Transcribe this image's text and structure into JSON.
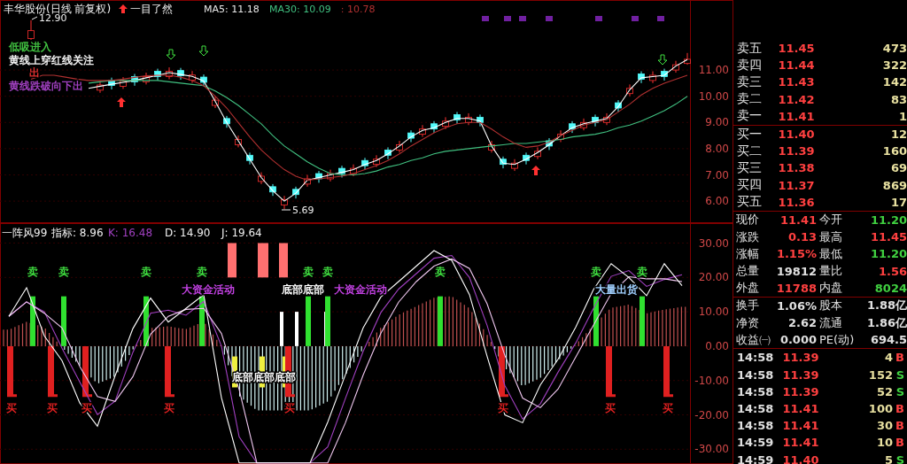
{
  "price_chart": {
    "title": "丰华股份(日线 前复权)",
    "indicator": "一目了然",
    "ma_legend": [
      {
        "label": "MA5: 11.18",
        "color": "#e8e8e8"
      },
      {
        "label": "MA30: 10.09",
        "color": "#40c080"
      },
      {
        "label": ": 10.78",
        "color": "#b03030"
      }
    ],
    "high_label": "12.90",
    "low_label": "5.69",
    "legend": [
      {
        "text": "低吸进入",
        "color": "#40c040"
      },
      {
        "text": "黄线上穿红线关注",
        "color": "#f0f0f0"
      },
      {
        "text": "出",
        "color": "#e03030"
      },
      {
        "text": "黄线跌破向下出",
        "color": "#a040c0"
      }
    ],
    "candles": {
      "chart_data": {
        "type": "candlestick",
        "ylim": [
          5.16,
          13.67
        ],
        "grid": true,
        "yticks": [
          {
            "value": 11,
            "label": "11.00"
          },
          {
            "value": 10,
            "label": "10.00"
          },
          {
            "value": 9,
            "label": "9.00"
          },
          {
            "value": 8,
            "label": "8.00"
          },
          {
            "value": 7,
            "label": "7.00"
          },
          {
            "value": 6,
            "label": "6.00"
          }
        ],
        "ohlc": [
          null,
          null,
          [
            12.2,
            12.9,
            12.15,
            12.5
          ],
          null,
          null,
          null,
          null,
          null,
          [
            10.23,
            10.58,
            10.13,
            10.43
          ],
          [
            10.61,
            10.71,
            10.26,
            10.41
          ],
          [
            10.38,
            10.73,
            10.28,
            10.58
          ],
          [
            10.75,
            10.85,
            10.4,
            10.55
          ],
          [
            10.55,
            10.9,
            10.45,
            10.75
          ],
          [
            10.95,
            11.05,
            10.6,
            10.75
          ],
          [
            10.75,
            11.1,
            10.65,
            10.95
          ],
          [
            10.98,
            11.08,
            10.63,
            10.78
          ],
          [
            10.61,
            10.96,
            10.51,
            10.81
          ],
          [
            10.73,
            10.83,
            10.38,
            10.53
          ],
          [
            9.65,
            10.0,
            9.55,
            9.85
          ],
          [
            9.15,
            9.25,
            8.8,
            8.95
          ],
          [
            8.15,
            8.5,
            8.05,
            8.35
          ],
          [
            7.75,
            7.85,
            7.4,
            7.55
          ],
          [
            6.75,
            7.1,
            6.65,
            6.95
          ],
          [
            6.55,
            6.65,
            6.2,
            6.35
          ],
          [
            5.85,
            6.2,
            5.69,
            6.05
          ],
          [
            6.45,
            6.55,
            6.1,
            6.25
          ],
          [
            6.65,
            7.0,
            6.55,
            6.85
          ],
          [
            7.05,
            7.15,
            6.7,
            6.85
          ],
          [
            6.85,
            7.2,
            6.75,
            7.05
          ],
          [
            7.25,
            7.35,
            6.9,
            7.05
          ],
          [
            7.05,
            7.4,
            6.95,
            7.25
          ],
          [
            7.55,
            7.65,
            7.2,
            7.35
          ],
          [
            7.4,
            7.75,
            7.3,
            7.6
          ],
          [
            7.95,
            8.05,
            7.6,
            7.75
          ],
          [
            7.95,
            8.3,
            7.85,
            8.15
          ],
          [
            8.6,
            8.7,
            8.25,
            8.4
          ],
          [
            8.55,
            8.9,
            8.45,
            8.75
          ],
          [
            8.95,
            9.05,
            8.6,
            8.75
          ],
          [
            8.85,
            9.2,
            8.75,
            9.05
          ],
          [
            9.3,
            9.4,
            8.95,
            9.1
          ],
          [
            9.0,
            9.35,
            8.9,
            9.2
          ],
          [
            9.2,
            9.3,
            8.85,
            9.0
          ],
          [
            7.95,
            8.3,
            7.85,
            8.15
          ],
          [
            7.6,
            7.7,
            7.25,
            7.4
          ],
          [
            7.25,
            7.6,
            7.15,
            7.45
          ],
          [
            7.75,
            7.85,
            7.4,
            7.55
          ],
          [
            7.7,
            8.05,
            7.6,
            7.9
          ],
          [
            8.3,
            8.4,
            7.95,
            8.1
          ],
          [
            8.35,
            8.7,
            8.25,
            8.55
          ],
          [
            8.95,
            9.05,
            8.6,
            8.75
          ],
          [
            8.8,
            9.15,
            8.7,
            9.0
          ],
          [
            9.2,
            9.3,
            8.85,
            9.0
          ],
          [
            9.0,
            9.35,
            8.9,
            9.2
          ],
          [
            9.75,
            9.85,
            9.4,
            9.55
          ],
          [
            10.1,
            10.45,
            10.0,
            10.3
          ],
          [
            10.85,
            10.95,
            10.5,
            10.65
          ],
          [
            10.6,
            10.95,
            10.5,
            10.8
          ],
          [
            10.95,
            11.05,
            10.6,
            10.75
          ],
          [
            11.0,
            11.35,
            10.9,
            11.2
          ],
          [
            11.25,
            11.65,
            11.2,
            11.41
          ]
        ]
      }
    },
    "moving_averages": {
      "chart_data": {
        "type": "line",
        "ylim": [
          5.16,
          13.67
        ],
        "series": [
          {
            "color": "#ffffff",
            "values": [
              null,
              null,
              null,
              null,
              null,
              null,
              null,
              10.3,
              10.38,
              10.46,
              10.53,
              10.6,
              10.7,
              10.8,
              10.9,
              10.83,
              10.76,
              10.58,
              9.8,
              9.0,
              8.3,
              7.6,
              6.9,
              6.4,
              6.0,
              6.3,
              6.8,
              6.9,
              7.0,
              7.1,
              7.2,
              7.4,
              7.55,
              7.8,
              8.1,
              8.45,
              8.7,
              8.8,
              9.0,
              9.15,
              9.15,
              9.05,
              8.1,
              7.45,
              7.4,
              7.6,
              7.85,
              8.15,
              8.5,
              8.8,
              8.95,
              9.05,
              9.15,
              9.6,
              10.25,
              10.7,
              10.75,
              10.8,
              11.15,
              11.4
            ]
          },
          {
            "color": "#40c080",
            "values": [
              null,
              null,
              null,
              null,
              null,
              null,
              null,
              10.5,
              10.55,
              10.6,
              10.6,
              10.6,
              10.6,
              10.6,
              10.55,
              10.5,
              10.45,
              10.4,
              10.2,
              9.95,
              9.65,
              9.3,
              8.95,
              8.5,
              8.1,
              7.8,
              7.5,
              7.25,
              7.05,
              7.0,
              7.0,
              7.05,
              7.15,
              7.3,
              7.4,
              7.55,
              7.65,
              7.8,
              7.9,
              7.95,
              8.0,
              8.05,
              8.1,
              8.15,
              8.2,
              8.2,
              8.25,
              8.3,
              8.35,
              8.45,
              8.5,
              8.55,
              8.65,
              8.8,
              8.9,
              9.05,
              9.25,
              9.45,
              9.7,
              10.0
            ]
          },
          {
            "color": "#b03030",
            "values": [
              null,
              null,
              10.65,
              10.8,
              10.8,
              10.73,
              10.65,
              10.6,
              10.6,
              10.6,
              10.65,
              10.72,
              10.78,
              10.8,
              10.8,
              10.73,
              10.6,
              10.4,
              10.0,
              9.55,
              9.0,
              8.45,
              7.95,
              7.55,
              7.2,
              6.95,
              6.8,
              6.85,
              6.9,
              6.95,
              7.05,
              7.2,
              7.35,
              7.55,
              7.8,
              8.1,
              8.35,
              8.6,
              8.8,
              8.95,
              9.0,
              9.0,
              8.75,
              8.45,
              8.2,
              8.05,
              8.1,
              8.25,
              8.5,
              8.7,
              8.9,
              9.0,
              9.1,
              9.4,
              9.7,
              10.05,
              10.3,
              10.5,
              10.65,
              10.8
            ]
          }
        ]
      }
    }
  },
  "indicator_chart": {
    "name": "一阵风99",
    "values": [
      {
        "label": "指标: 8.96",
        "color": "#f0f0f0"
      },
      {
        "label": "K: 16.48",
        "color": "#a040c0"
      },
      {
        "label": "D: 14.90",
        "color": "#f0f0f0"
      },
      {
        "label": "J: 19.64",
        "color": "#f0f0f0"
      }
    ],
    "signals": [
      {
        "kind": "buy",
        "label": "买"
      },
      {
        "kind": "sell",
        "label": "卖"
      },
      {
        "kind": "buy",
        "label": "买"
      },
      {
        "kind": "sell",
        "label": "卖"
      },
      {
        "kind": "buy",
        "label": "买"
      },
      {
        "kind": "sell",
        "label": "卖"
      },
      {
        "kind": "buy",
        "label": "买"
      },
      {
        "kind": "sell",
        "label": "卖"
      },
      {
        "kind": "sell",
        "label": "卖"
      },
      {
        "kind": "sell",
        "label": "卖"
      },
      {
        "kind": "buy",
        "label": "买"
      },
      {
        "kind": "sell",
        "label": "卖"
      },
      {
        "kind": "buy",
        "label": "买"
      },
      {
        "kind": "buy",
        "label": "买"
      },
      {
        "kind": "sell",
        "label": "卖"
      },
      {
        "kind": "buy",
        "label": "买"
      },
      {
        "kind": "sell",
        "label": "卖"
      }
    ],
    "notes": [
      {
        "text": "大资金活动",
        "color": "#c040e0"
      },
      {
        "text": "底部底部",
        "color": "#ffffff"
      },
      {
        "text": "大资金活动",
        "color": "#c040e0"
      },
      {
        "text": "底部底部底部",
        "color": "#ffffff"
      },
      {
        "text": "大量出货",
        "color": "#a0d0ff"
      }
    ],
    "chart_data": {
      "type": "line",
      "ylim": [
        -34.3,
        35.8
      ],
      "grid": true,
      "yticks": [
        {
          "value": 30,
          "label": "30.00"
        },
        {
          "value": 20,
          "label": "20.00"
        },
        {
          "value": 10,
          "label": "10.00"
        },
        {
          "value": 0,
          "label": "0.00"
        },
        {
          "value": -10,
          "label": "-10.00"
        },
        {
          "value": -20,
          "label": "-20.00"
        },
        {
          "value": -30,
          "label": "-30.00"
        }
      ],
      "series": [
        {
          "color": "#a040c0",
          "values": [
            8.7,
            12.9,
            10,
            -0.6,
            -10.4,
            -19.9,
            -16,
            -1.8,
            9.6,
            10.5,
            9,
            13,
            0,
            -26.4,
            -34,
            -34,
            -34,
            -34,
            -29.3,
            -15.2,
            -1.5,
            9.8,
            16.6,
            21.1,
            25.6,
            26.4,
            20,
            6,
            -11.5,
            -21.2,
            -16.8,
            -7.6,
            0.9,
            11,
            20.3,
            22,
            17.4,
            19.4,
            20.8
          ]
        },
        {
          "color": "#f0c8f0",
          "values": [
            8.7,
            12.9,
            9.6,
            5.3,
            -5.9,
            -14.7,
            -16.1,
            -8.9,
            3.5,
            8.7,
            10.7,
            11,
            3.7,
            -12.6,
            -34,
            -34,
            -34,
            -34,
            -34,
            -22.3,
            -8.4,
            3.8,
            12.8,
            18.8,
            23.3,
            25.4,
            22.6,
            12.3,
            -2.7,
            -15.1,
            -17.9,
            -12.5,
            -3.2,
            6.1,
            15.3,
            20.2,
            19.6,
            19.6,
            18.8
          ]
        },
        {
          "color": "#ffffff",
          "values": [
            8.7,
            17,
            3,
            -4.2,
            -16.5,
            -23.3,
            -8.6,
            5.1,
            14,
            7,
            11,
            15,
            -15,
            -34,
            -34,
            -34,
            -34,
            -34,
            -22.1,
            -8.3,
            5.3,
            14.3,
            18.8,
            23.3,
            27.8,
            25,
            15,
            -3,
            -20,
            -22.3,
            -11.3,
            -3.8,
            5.5,
            16.5,
            24,
            20,
            14.7,
            24,
            17.6
          ]
        }
      ]
    }
  },
  "order_book": [
    {
      "label": "卖五",
      "price": "11.45",
      "volume": "473"
    },
    {
      "label": "卖四",
      "price": "11.44",
      "volume": "322"
    },
    {
      "label": "卖三",
      "price": "11.43",
      "volume": "142"
    },
    {
      "label": "卖二",
      "price": "11.42",
      "volume": "83"
    },
    {
      "label": "卖一",
      "price": "11.41",
      "volume": "1"
    },
    {
      "label": "买一",
      "price": "11.40",
      "volume": "12"
    },
    {
      "label": "买二",
      "price": "11.39",
      "volume": "160"
    },
    {
      "label": "买三",
      "price": "11.38",
      "volume": "69"
    },
    {
      "label": "买四",
      "price": "11.37",
      "volume": "869"
    },
    {
      "label": "买五",
      "price": "11.36",
      "volume": "17"
    }
  ],
  "stats": [
    {
      "cells": [
        {
          "label": "现价",
          "value": "11.41",
          "color": "#ff4040"
        },
        {
          "label": "今开",
          "value": "11.20",
          "color": "#40d040"
        }
      ]
    },
    {
      "cells": [
        {
          "label": "涨跌",
          "value": "0.13",
          "color": "#ff4040"
        },
        {
          "label": "最高",
          "value": "11.45",
          "color": "#ff4040"
        }
      ]
    },
    {
      "cells": [
        {
          "label": "涨幅",
          "value": "1.15%",
          "color": "#ff4040"
        },
        {
          "label": "最低",
          "value": "11.20",
          "color": "#40d040"
        }
      ]
    },
    {
      "cells": [
        {
          "label": "总量",
          "value": "19812",
          "color": "#e0e0e0"
        },
        {
          "label": "量比",
          "value": "1.56",
          "color": "#ff4040"
        }
      ]
    },
    {
      "cells": [
        {
          "label": "外盘",
          "value": "11788",
          "color": "#ff4040"
        },
        {
          "label": "内盘",
          "value": "8024",
          "color": "#40d040"
        }
      ]
    },
    {
      "cells": [
        {
          "label": "换手",
          "value": "1.06%",
          "color": "#e0e0e0"
        },
        {
          "label": "股本",
          "value": "1.88亿",
          "color": "#e0e0e0"
        }
      ]
    },
    {
      "cells": [
        {
          "label": "净资",
          "value": "2.62",
          "color": "#e0e0e0"
        },
        {
          "label": "流通",
          "value": "1.86亿",
          "color": "#e0e0e0"
        }
      ]
    },
    {
      "cells": [
        {
          "label": "收益㈠",
          "value": "0.000",
          "color": "#e0e0e0"
        },
        {
          "label": "PE(动)",
          "value": "694.5",
          "color": "#e0e0e0"
        }
      ]
    }
  ],
  "ticks": [
    {
      "time": "14:58",
      "price": "11.39",
      "volume": "4",
      "side": "B",
      "kind": "buy"
    },
    {
      "time": "14:58",
      "price": "11.39",
      "volume": "152",
      "side": "S",
      "kind": "sell"
    },
    {
      "time": "14:58",
      "price": "11.39",
      "volume": "52",
      "side": "S",
      "kind": "sell"
    },
    {
      "time": "14:58",
      "price": "11.41",
      "volume": "100",
      "side": "B",
      "kind": "buy"
    },
    {
      "time": "14:58",
      "price": "11.41",
      "volume": "30",
      "side": "B",
      "kind": "buy"
    },
    {
      "time": "14:59",
      "price": "11.41",
      "volume": "10",
      "side": "B",
      "kind": "buy"
    },
    {
      "time": "14:59",
      "price": "11.40",
      "volume": "5",
      "side": "S",
      "kind": "sell"
    }
  ]
}
